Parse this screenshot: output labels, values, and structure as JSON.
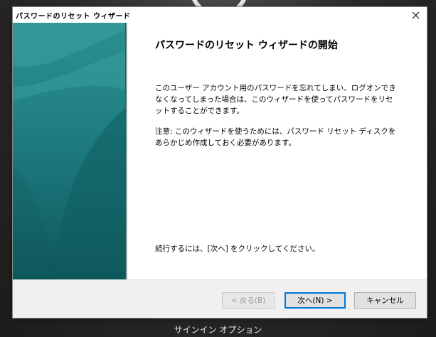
{
  "window": {
    "title": "パスワードのリセット ウィザード",
    "close_icon": "close-icon"
  },
  "content": {
    "heading": "パスワードのリセット ウィザードの開始",
    "paragraph1": "このユーザー アカウント用のパスワードを忘れてしまい、ログオンできなくなってしまった場合は、このウィザードを使ってパスワードをリセットすることができます。",
    "paragraph2": "注意: このウィザードを使うためには、パスワード リセット ディスクをあらかじめ作成しておく必要があります。",
    "instruction": "続行するには、[次へ] をクリックしてください。"
  },
  "buttons": {
    "back": "< 戻る(B)",
    "next": "次へ(N) >",
    "cancel": "キャンセル"
  },
  "background": {
    "label": "サインイン オプション"
  },
  "colors": {
    "banner": "#1f7f82",
    "focus": "#0078d7"
  }
}
